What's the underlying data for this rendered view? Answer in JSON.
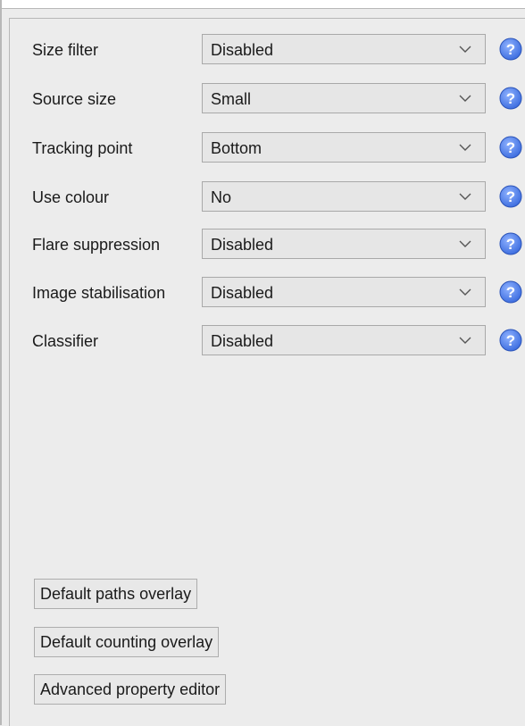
{
  "settings": [
    {
      "label": "Size filter",
      "value": "Disabled"
    },
    {
      "label": "Source size",
      "value": "Small"
    },
    {
      "label": "Tracking point",
      "value": "Bottom"
    },
    {
      "label": "Use colour",
      "value": "No"
    },
    {
      "label": "Flare suppression",
      "value": "Disabled"
    },
    {
      "label": "Image stabilisation",
      "value": "Disabled"
    },
    {
      "label": "Classifier",
      "value": "Disabled"
    }
  ],
  "buttons": {
    "paths_overlay": "Default paths overlay",
    "counting_overlay": "Default counting overlay",
    "property_editor": "Advanced property editor"
  },
  "icons": {
    "dropdown": "chevron-down-icon",
    "help": "help-icon"
  },
  "colors": {
    "help_icon": "#3f6fe0",
    "background": "#ececec"
  }
}
